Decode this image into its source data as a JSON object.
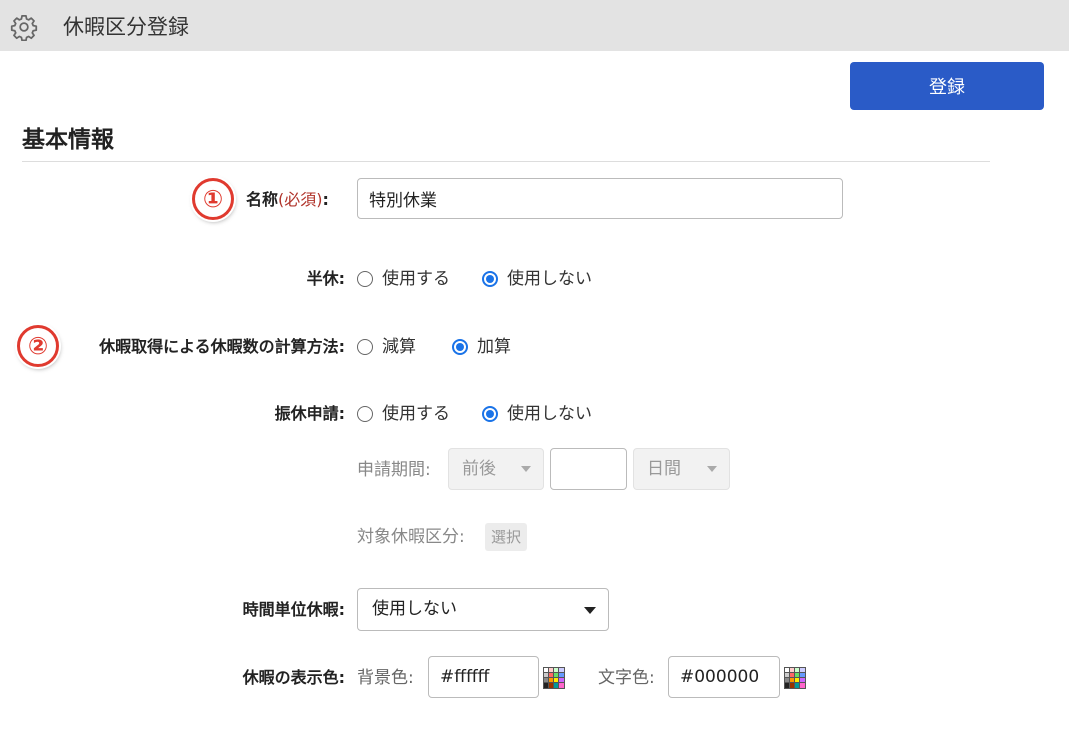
{
  "header": {
    "title": "休暇区分登録",
    "icon": "gear-icon"
  },
  "toolbar": {
    "register_label": "登録"
  },
  "section": {
    "title": "基本情報"
  },
  "markers": {
    "first": "①",
    "second": "②"
  },
  "form": {
    "name": {
      "label": "名称",
      "required": "(必須)",
      "suffix": ":",
      "value": "特別休業"
    },
    "half_day": {
      "label": "半休:",
      "options": [
        "使用する",
        "使用しない"
      ],
      "selected": "使用しない"
    },
    "calc_method": {
      "label": "休暇取得による休暇数の計算方法:",
      "options": [
        "減算",
        "加算"
      ],
      "selected": "加算"
    },
    "substitute": {
      "label": "振休申請:",
      "options": [
        "使用する",
        "使用しない"
      ],
      "selected": "使用しない",
      "period_label": "申請期間:",
      "period_direction": "前後",
      "period_value": "",
      "period_unit": "日間",
      "target_label": "対象休暇区分:",
      "target_button": "選択"
    },
    "hourly_leave": {
      "label": "時間単位休暇:",
      "value": "使用しない"
    },
    "display_color": {
      "label": "休暇の表示色:",
      "bg_label": "背景色:",
      "bg_value": "#ffffff",
      "text_label": "文字色:",
      "text_value": "#000000"
    }
  },
  "colors": {
    "primary": "#2a5bc7",
    "marker": "#e03a2f",
    "required": "#b0332a",
    "radio": "#1a73e8"
  }
}
